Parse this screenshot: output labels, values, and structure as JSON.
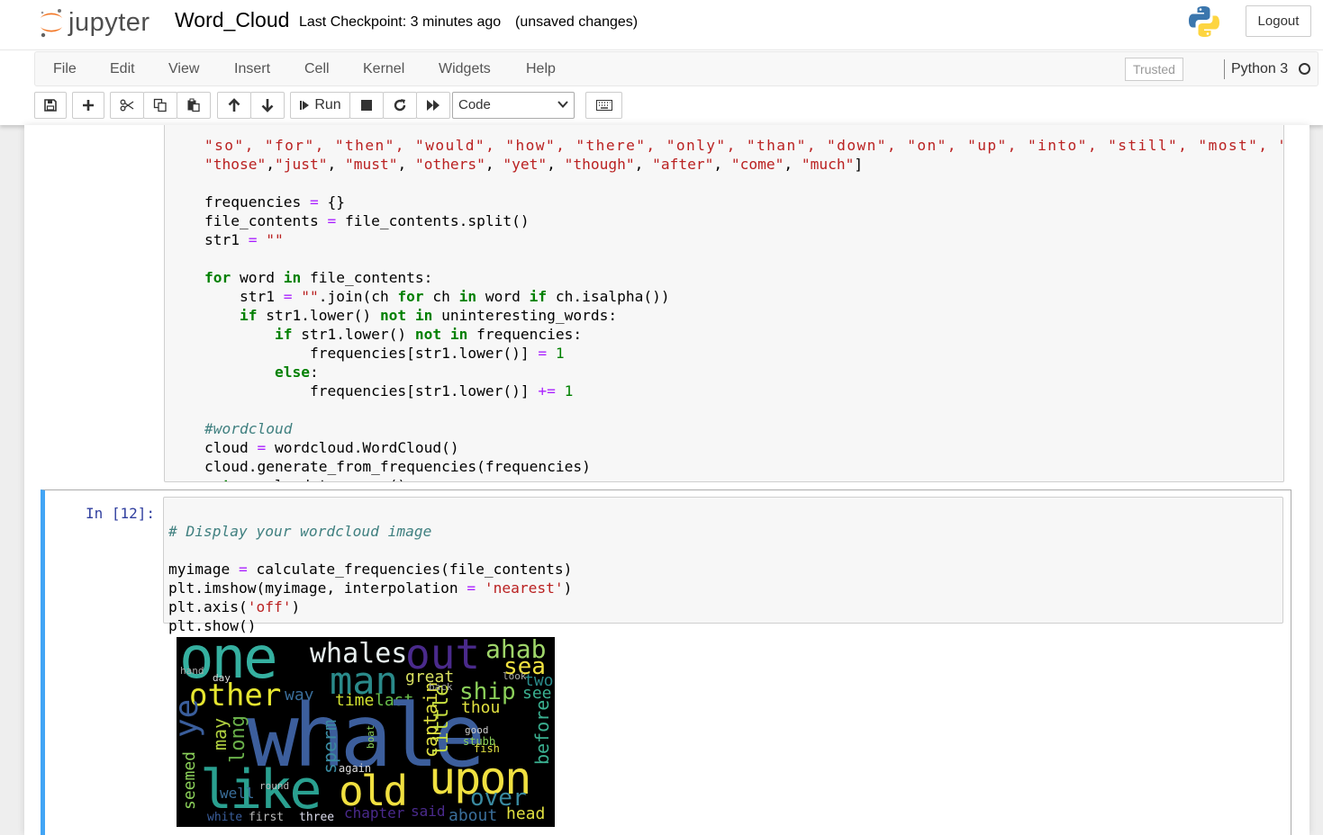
{
  "header": {
    "logo_text": "jupyter",
    "notebook_title": "Word_Cloud",
    "checkpoint": "Last Checkpoint: 3 minutes ago",
    "unsaved": "(unsaved changes)",
    "logout_label": "Logout"
  },
  "menu": {
    "items": [
      "File",
      "Edit",
      "View",
      "Insert",
      "Cell",
      "Kernel",
      "Widgets",
      "Help"
    ],
    "trusted": "Trusted",
    "kernel_name": "Python 3"
  },
  "toolbar": {
    "run_label": "Run",
    "cell_type": "Code"
  },
  "cell1": {
    "lines": [
      "\"so\", \"for\", \"then\", \"would\", \"how\", \"there\", \"only\", \"than\", \"down\", \"on\", \"up\", \"into\", \"still\", \"most\", \"while\", \\",
      "\"those\",\"just\", \"must\", \"others\", \"yet\", \"though\", \"after\", \"come\", \"much\"]",
      "",
      "frequencies = {}",
      "file_contents = file_contents.split()",
      "str1 = \"\"",
      "",
      "for word in file_contents:",
      "    str1 = \"\".join(ch for ch in word if ch.isalpha())",
      "    if str1.lower() not in uninteresting_words:",
      "        if str1.lower() not in frequencies:",
      "            frequencies[str1.lower()] = 1",
      "        else:",
      "            frequencies[str1.lower()] += 1",
      "",
      "#wordcloud",
      "cloud = wordcloud.WordCloud()",
      "cloud.generate_from_frequencies(frequencies)",
      "return cloud.to_array()"
    ]
  },
  "cell2": {
    "prompt": "In [12]:",
    "lines": [
      "# Display your wordcloud image",
      "",
      "myimage = calculate_frequencies(file_contents)",
      "plt.imshow(myimage, interpolation = 'nearest')",
      "plt.axis('off')",
      "plt.show()"
    ]
  },
  "wordcloud": {
    "words": [
      "one",
      "whales",
      "out",
      "ahab",
      "sea",
      "man",
      "great",
      "other",
      "way",
      "time",
      "last",
      "ship",
      "see",
      "two",
      "thou",
      "whale",
      "ye",
      "long",
      "may",
      "sperm",
      "captain",
      "little",
      "before",
      "like",
      "old",
      "upon",
      "over",
      "seemed",
      "well",
      "first",
      "three",
      "chapter",
      "said",
      "about",
      "head",
      "boat",
      "white",
      "again",
      "look",
      "good",
      "round",
      "stubb",
      "hand",
      "day",
      "back",
      "fish"
    ]
  }
}
